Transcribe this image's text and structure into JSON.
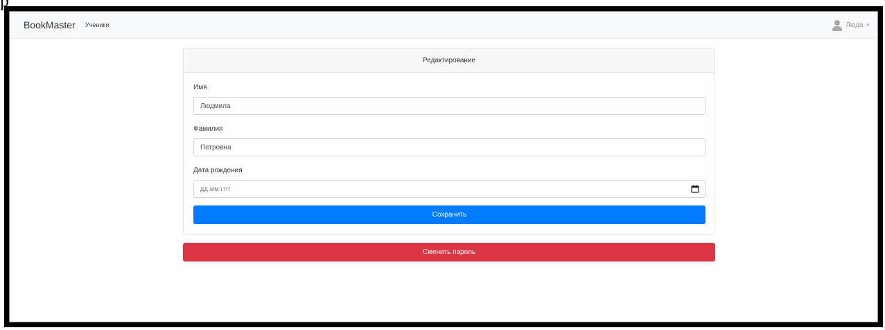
{
  "artifact": {
    "top_glyph": "р"
  },
  "navbar": {
    "brand": "BookMaster",
    "link": "Ученики",
    "user_name": "Люда",
    "caret": "▾",
    "user_icon": "user-icon"
  },
  "card": {
    "header": "Редактирование",
    "fields": {
      "first_name": {
        "label": "Имя",
        "value": "Людмила"
      },
      "last_name": {
        "label": "Фамилия",
        "value": "Петровна"
      },
      "birth_date": {
        "label": "Дата рождения",
        "placeholder": "дд.мм.гггг",
        "icon": "calendar-icon"
      }
    },
    "save_label": "Сохранить"
  },
  "change_password_label": "Сменить пароль",
  "colors": {
    "primary": "#007bff",
    "danger": "#dc3545",
    "navbar_bg": "#f8f9fa"
  }
}
